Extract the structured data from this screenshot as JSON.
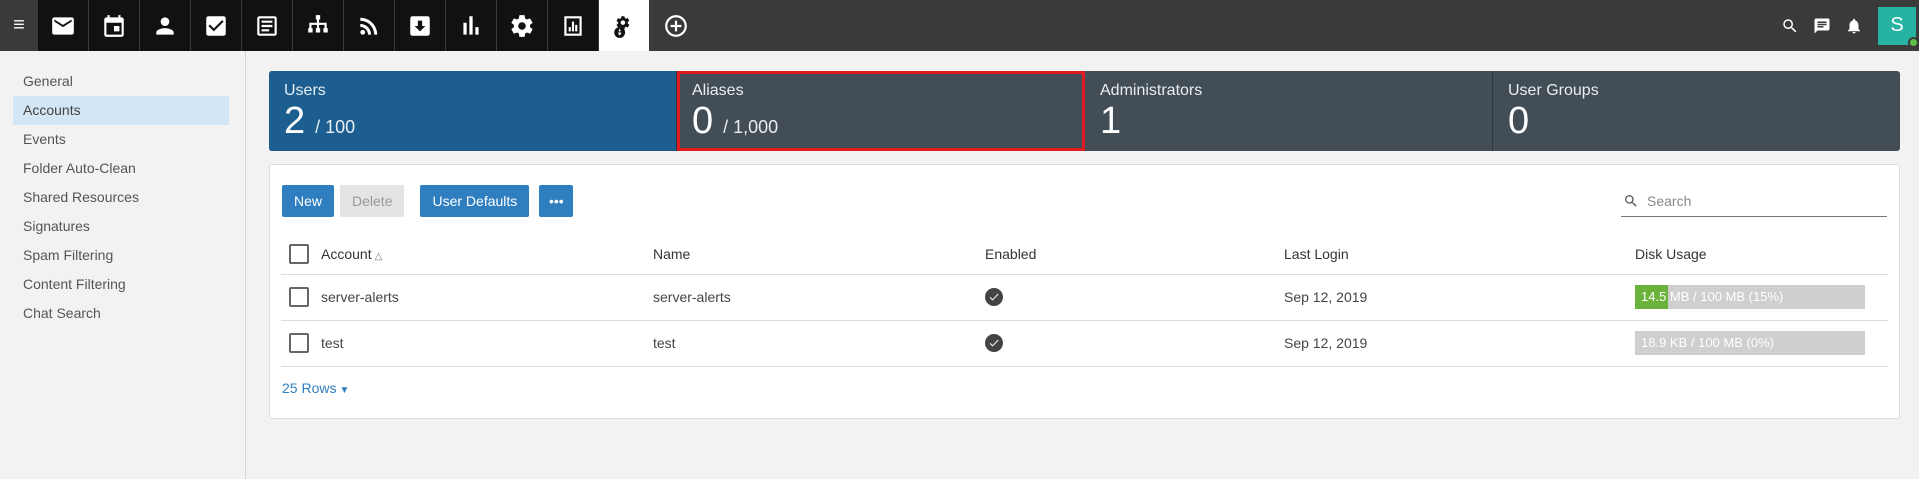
{
  "topbar": {
    "apps": [
      {
        "icon": "mail-icon"
      },
      {
        "icon": "calendar-icon"
      },
      {
        "icon": "contacts-icon"
      },
      {
        "icon": "tasks-icon"
      },
      {
        "icon": "notes-icon"
      },
      {
        "icon": "sitemap-icon"
      },
      {
        "icon": "rss-icon"
      },
      {
        "icon": "file-storage-icon"
      },
      {
        "icon": "reports-icon"
      },
      {
        "icon": "settings-icon"
      },
      {
        "icon": "domain-reports-icon"
      },
      {
        "icon": "domain-settings-icon",
        "active": true
      },
      {
        "icon": "add-circle-icon"
      }
    ],
    "right_icons": [
      "search-icon",
      "chat-icon",
      "bell-icon"
    ],
    "avatar_letter": "S"
  },
  "sidebar": {
    "items": [
      {
        "label": "General"
      },
      {
        "label": "Accounts",
        "active": true
      },
      {
        "label": "Events"
      },
      {
        "label": "Folder Auto-Clean"
      },
      {
        "label": "Shared Resources"
      },
      {
        "label": "Signatures"
      },
      {
        "label": "Spam Filtering"
      },
      {
        "label": "Content Filtering"
      },
      {
        "label": "Chat Search"
      }
    ]
  },
  "stats": {
    "users": {
      "label": "Users",
      "value": "2",
      "limit": "/ 100"
    },
    "aliases": {
      "label": "Aliases",
      "value": "0",
      "limit": "/ 1,000"
    },
    "administrators": {
      "label": "Administrators",
      "value": "1"
    },
    "user_groups": {
      "label": "User Groups",
      "value": "0"
    }
  },
  "toolbar": {
    "new_label": "New",
    "delete_label": "Delete",
    "user_defaults_label": "User Defaults",
    "more_label": "•••",
    "search_placeholder": "Search"
  },
  "table": {
    "headers": {
      "account": "Account",
      "name": "Name",
      "enabled": "Enabled",
      "last_login": "Last Login",
      "disk_usage": "Disk Usage"
    },
    "rows": [
      {
        "account": "server-alerts",
        "name": "server-alerts",
        "enabled": true,
        "last_login": "Sep 12, 2019",
        "disk_text": "14.5 MB / 100 MB (15%)",
        "disk_fraction": 0.145
      },
      {
        "account": "test",
        "name": "test",
        "enabled": true,
        "last_login": "Sep 12, 2019",
        "disk_text": "18.9 KB / 100 MB (0%)",
        "disk_fraction": 0.0
      }
    ]
  },
  "pagination": {
    "rows_label": "25 Rows"
  },
  "colors": {
    "accent": "#2f7fc0",
    "users_tile": "#1b5e8f",
    "tile": "#434d55",
    "disk_fill": "#6ab23a",
    "highlight": "#e21b23"
  }
}
